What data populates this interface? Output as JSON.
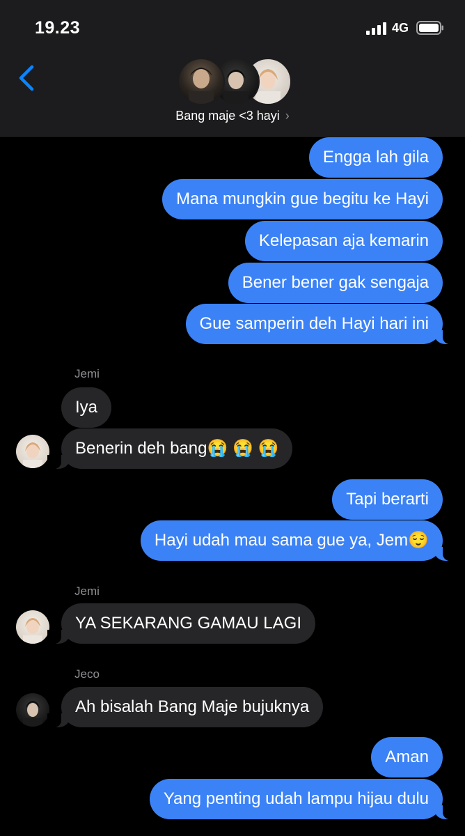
{
  "status_bar": {
    "time": "19.23",
    "network": "4G"
  },
  "header": {
    "chat_name": "Bang maje <3 hayi",
    "chevron": "›"
  },
  "messages": [
    {
      "from": "me",
      "text": "Engga lah gila"
    },
    {
      "from": "me",
      "text": "Mana mungkin gue begitu ke Hayi"
    },
    {
      "from": "me",
      "text": "Kelepasan aja kemarin"
    },
    {
      "from": "me",
      "text": "Bener bener gak sengaja"
    },
    {
      "from": "me",
      "text": "Gue samperin deh Hayi hari ini"
    },
    {
      "from": "Jemi",
      "sender_label": "Jemi",
      "text": "Iya"
    },
    {
      "from": "Jemi",
      "text": "Benerin deh bang😭 😭 😭"
    },
    {
      "from": "me",
      "text": "Tapi berarti"
    },
    {
      "from": "me",
      "text": "Hayi udah mau sama gue ya, Jem😌"
    },
    {
      "from": "Jemi",
      "sender_label": "Jemi",
      "text": "YA SEKARANG GAMAU LAGI"
    },
    {
      "from": "Jeco",
      "sender_label": "Jeco",
      "text": "Ah bisalah Bang Maje bujuknya"
    },
    {
      "from": "me",
      "text": "Aman"
    },
    {
      "from": "me",
      "text": "Yang penting udah lampu hijau dulu"
    }
  ],
  "colors": {
    "outgoing": "#3b82f6",
    "incoming": "#262628",
    "background": "#000000",
    "header": "#1c1c1e"
  },
  "icons": [
    "signal-icon",
    "battery-icon",
    "back-chevron-icon",
    "group-avatar",
    "avatar"
  ]
}
